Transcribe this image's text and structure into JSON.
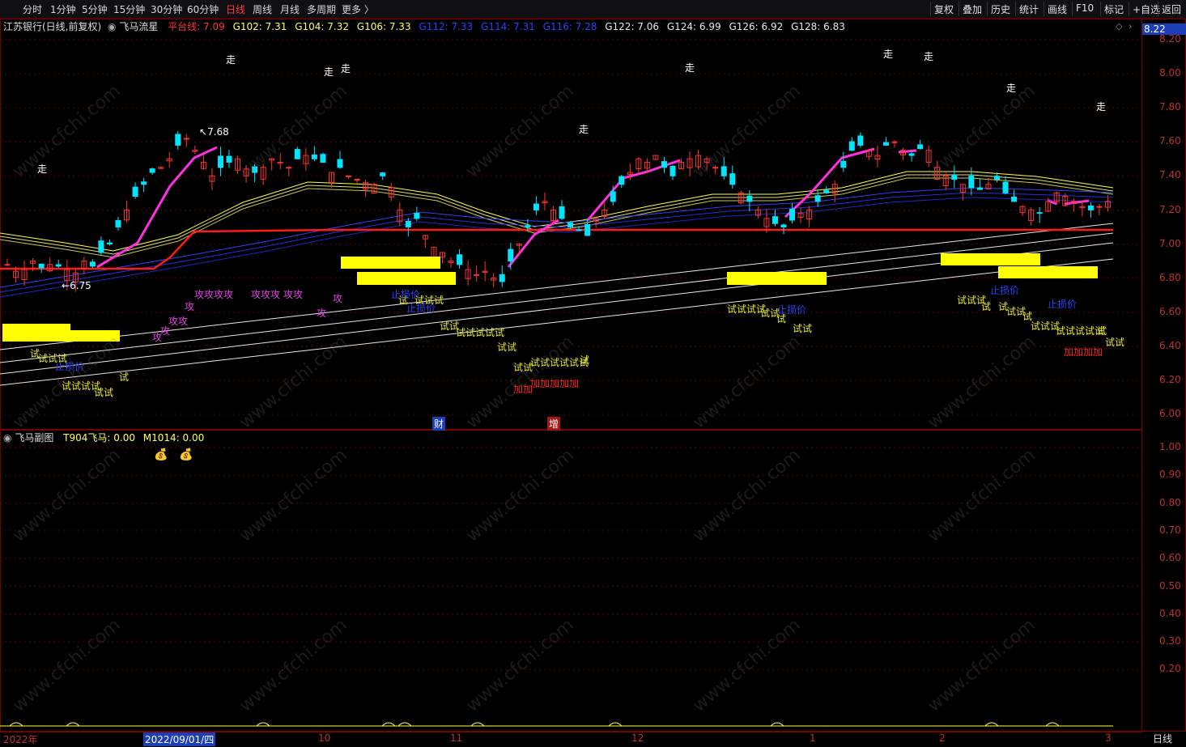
{
  "toolbar": {
    "periods": [
      "分时",
      "1分钟",
      "5分钟",
      "15分钟",
      "30分钟",
      "60分钟",
      "日线",
      "周线",
      "月线",
      "多周期",
      "更多 〉"
    ],
    "active_period": "日线",
    "right_buttons": [
      "复权",
      "叠加",
      "历史",
      "统计",
      "画线",
      "F10",
      "标记",
      "+自选",
      "返回"
    ]
  },
  "main_info": {
    "stock": "江苏银行(日线,前复权)",
    "indicator": "飞马流星",
    "pingtai": "平台线: 7.09",
    "g102": "G102: 7.31",
    "g104": "G104: 7.32",
    "g106": "G106: 7.33",
    "g112": "G112: 7.33",
    "g114": "G114: 7.31",
    "g116": "G116: 7.28",
    "g122": "G122: 7.06",
    "g124": "G124: 6.99",
    "g126": "G126: 6.92",
    "g128": "G128: 6.83",
    "current_price": "8.22"
  },
  "sub_info": {
    "title": "飞马副图",
    "t904": "T904飞马: 0.00",
    "m1014": "M1014: 0.00"
  },
  "y_axis_main": [
    "8.20",
    "8.00",
    "7.80",
    "7.60",
    "7.40",
    "7.20",
    "7.00",
    "6.80",
    "6.60",
    "6.40",
    "6.20",
    "6.00"
  ],
  "y_axis_sub": [
    "1.00",
    "0.90",
    "0.80",
    "0.70",
    "0.60",
    "0.50",
    "0.40",
    "0.30",
    "0.20"
  ],
  "x_axis": [
    "2022年",
    "2022/09/01/四",
    "10",
    "11",
    "12",
    "1",
    "2",
    "3"
  ],
  "period_label": "日线",
  "price_marks": {
    "high": "7.68",
    "low": "6.75"
  },
  "annotations": {
    "zou": "走",
    "cai": "财",
    "zeng": "增",
    "gong1": "攻攻攻攻",
    "gong2": "攻攻攻",
    "gong3": "攻攻",
    "gong": "攻",
    "shi": "试",
    "shishi": "试试",
    "shi3": "试试试",
    "shi4": "试试试试",
    "shi5": "试试试试试",
    "shi6": "试试试试试试",
    "jia2": "加加",
    "jia5": "加加加加加",
    "jia4": "加加加加",
    "stop": "止损价"
  },
  "watermark": "www.cfchi.com",
  "colors": {
    "up": "#ff3232",
    "down": "#00e5ff",
    "magenta": "#ff30e0",
    "yellow": "#ffff00",
    "platform": "#ff1a1a",
    "blue": "#2030ff"
  }
}
